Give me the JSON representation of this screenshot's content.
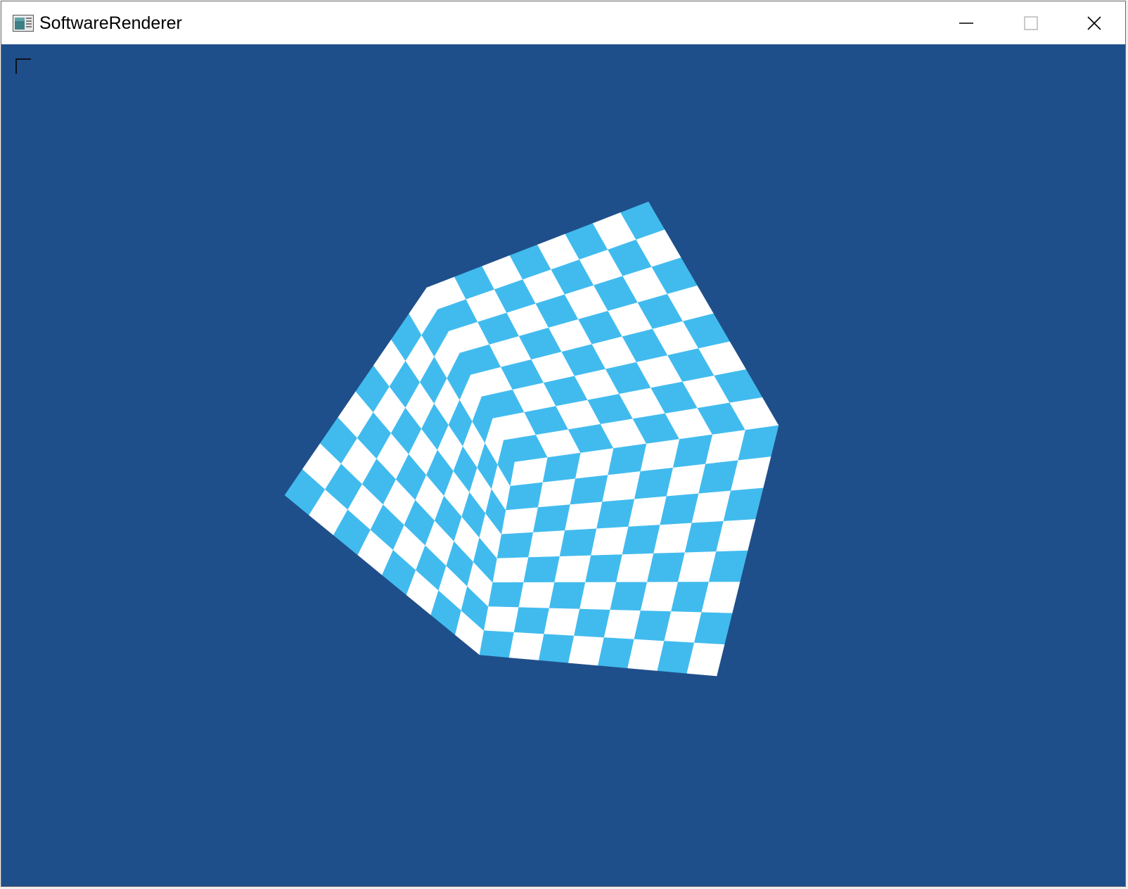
{
  "window": {
    "title": "SoftwareRenderer",
    "icon": "app-window-icon",
    "controls": {
      "minimize_icon": "minimize-icon",
      "maximize_icon": "maximize-icon",
      "close_icon": "close-icon"
    }
  },
  "viewport": {
    "background_color": "#1f4f8a",
    "checker_colors": [
      "#ffffff",
      "#41bbee"
    ],
    "checker_divisions": 8
  }
}
